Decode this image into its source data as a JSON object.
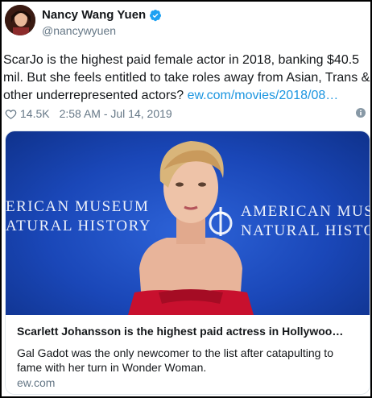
{
  "author": {
    "display_name": "Nancy Wang Yuen",
    "handle": "@nancywyuen",
    "verified": true
  },
  "tweet": {
    "text_line1": "ScarJo is the highest paid female actor in 2018, banking $40.5",
    "text_line2": "mil. But she feels entitled to take roles away from Asian, Trans &",
    "text_line3_plain": "other underrepresented actors?",
    "link_text": "ew.com/movies/2018/08…"
  },
  "meta": {
    "like_count": "14.5K",
    "timestamp": "2:58 AM - Jul 14, 2019",
    "heart_icon": "heart-icon",
    "info_icon": "info-icon"
  },
  "card": {
    "backdrop_left_line1": "ERICAN MUSEUM",
    "backdrop_left_line2": "ATURAL HISTORY",
    "backdrop_right_line1": "AMERICAN MUSEU",
    "backdrop_right_line2": "NATURAL HISTOR",
    "title": "Scarlett Johansson is the highest paid actress in Hollywoo…",
    "description": "Gal Gadot was the only newcomer to the list after catapulting to fame with her turn in Wonder Woman.",
    "domain": "ew.com"
  },
  "colors": {
    "link": "#1b95e0",
    "muted": "#657786",
    "verified": "#1da1f2",
    "backdrop": "#1a47b8",
    "dress": "#c8102e"
  }
}
